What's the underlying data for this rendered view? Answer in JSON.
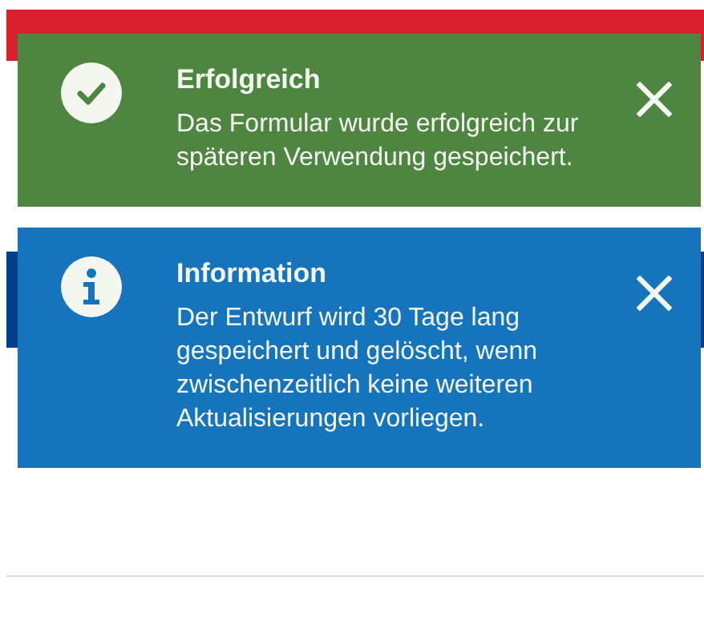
{
  "toasts": [
    {
      "kind": "success",
      "title": "Erfolgreich",
      "message": "Das Formular wurde erfolgreich zur späteren Verwendung gespeichert."
    },
    {
      "kind": "info",
      "title": "Information",
      "message": "Der Entwurf wird 30 Tage lang gespeichert und gelöscht, wenn zwischenzeitlich keine weiteren Aktualisierungen vorliegen."
    }
  ]
}
